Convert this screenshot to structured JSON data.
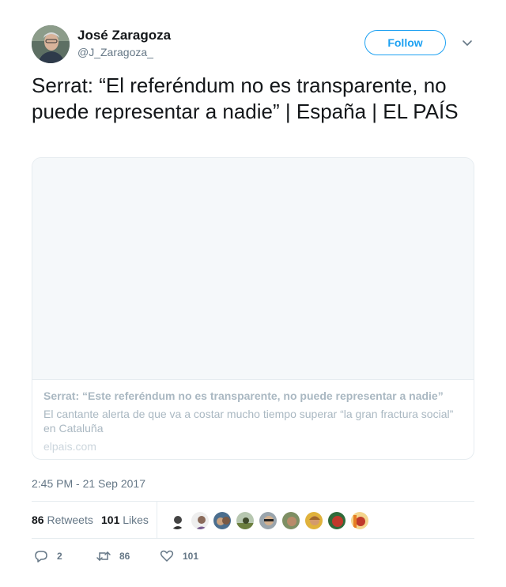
{
  "user": {
    "name": "José Zaragoza",
    "handle": "@J_Zaragoza_"
  },
  "follow_label": "Follow",
  "tweet_text": "Serrat: “El referéndum no es transparente, no puede representar a nadie” | España | EL PAÍS",
  "card": {
    "title": "Serrat: “Este referéndum no es transparente, no puede representar a nadie”",
    "description": "El cantante alerta de que va a costar mucho tiempo superar “la gran fractura social” en Cataluña",
    "domain": "elpais.com"
  },
  "timestamp": "2:45 PM - 21 Sep 2017",
  "stats": {
    "retweets_count": "86",
    "retweets_label": "Retweets",
    "likes_count": "101",
    "likes_label": "Likes"
  },
  "actions": {
    "reply_count": "2",
    "retweet_count": "86",
    "like_count": "101"
  },
  "colors": {
    "accent": "#1da1f2",
    "muted_text": "#657786",
    "border": "#e6ecf0"
  },
  "icons": [
    "avatar",
    "chevron-down-icon",
    "reply-icon",
    "retweet-icon",
    "heart-icon"
  ]
}
